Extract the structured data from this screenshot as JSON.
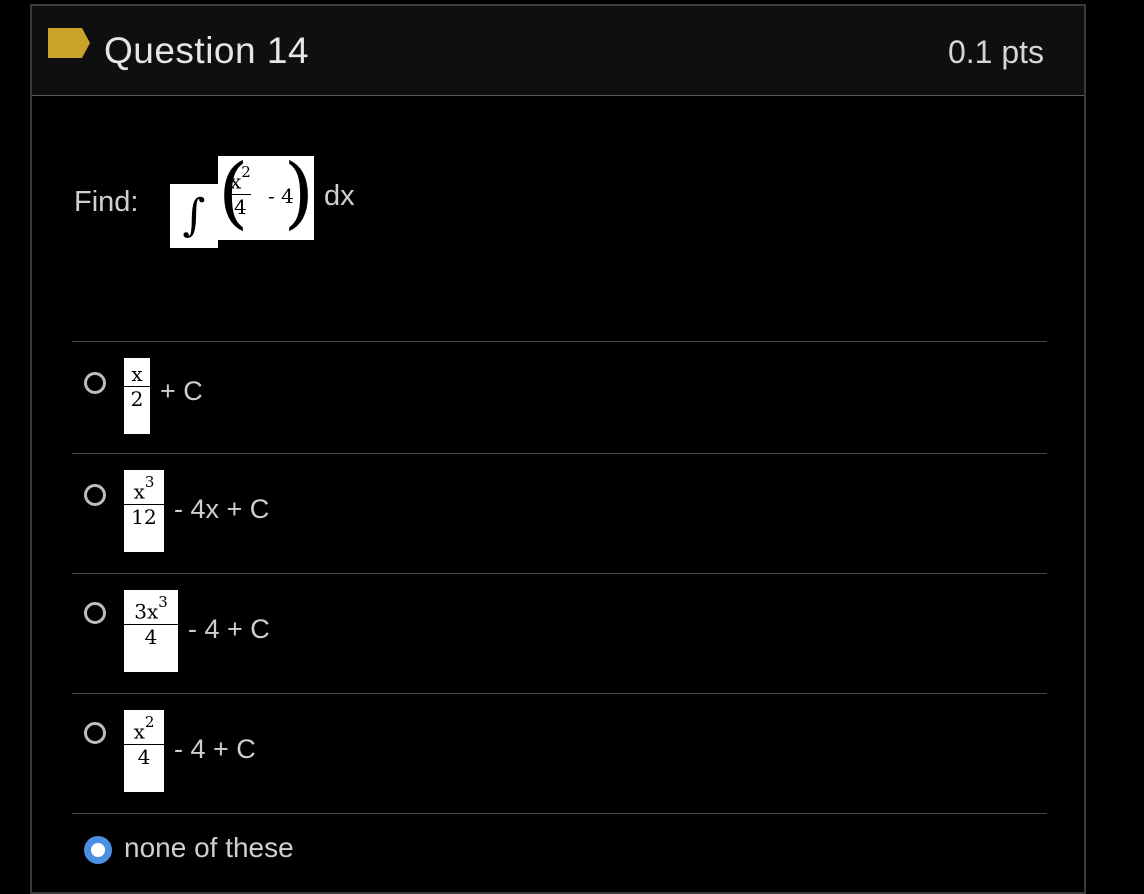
{
  "question": {
    "title": "Question 14",
    "points": "0.1 pts",
    "prompt_label": "Find:",
    "integral_symbol": "∫",
    "integrand_numerator_base": "x",
    "integrand_numerator_exp": "2",
    "integrand_denominator": "4",
    "integrand_tail": "- 4",
    "differential": "dx"
  },
  "options": [
    {
      "num_base": "x",
      "num_exp": "",
      "den": "2",
      "suffix": "+ C",
      "selected": false
    },
    {
      "num_base": "x",
      "num_exp": "3",
      "den": "12",
      "suffix": "- 4x + C",
      "selected": false
    },
    {
      "num_base": "3x",
      "num_exp": "3",
      "den": "4",
      "suffix": "- 4 + C",
      "selected": false
    },
    {
      "num_base": "x",
      "num_exp": "2",
      "den": "4",
      "suffix": "- 4 + C",
      "selected": false
    },
    {
      "text": "none of these",
      "selected": true
    }
  ],
  "colors": {
    "accent": "#4a90e2",
    "tag": "#c9a227",
    "background": "#000000",
    "header": "#0f0f0f"
  },
  "icons": {
    "tag": "tag-icon",
    "radio": "radio-icon"
  }
}
